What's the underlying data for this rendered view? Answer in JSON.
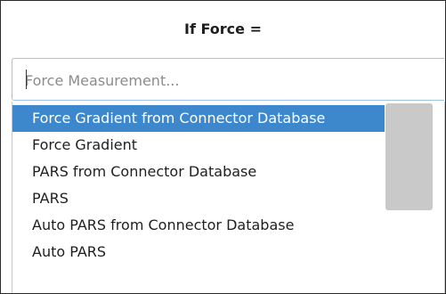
{
  "header": {
    "title": "If Force ="
  },
  "search": {
    "placeholder": "Force Measurement...",
    "value": ""
  },
  "dropdown": {
    "selected_index": 0,
    "options": [
      "Force Gradient from Connector Database",
      "Force Gradient",
      "PARS from Connector Database",
      "PARS",
      "Auto PARS from Connector Database",
      "Auto PARS"
    ],
    "scroll_position": 0.0,
    "visible_fraction": 0.56
  },
  "colors": {
    "selection": "#3d87cc",
    "focus_border": "#9ec3e6",
    "scrollbar_thumb": "#c9c9c9",
    "placeholder_text": "#8c8c8c"
  }
}
